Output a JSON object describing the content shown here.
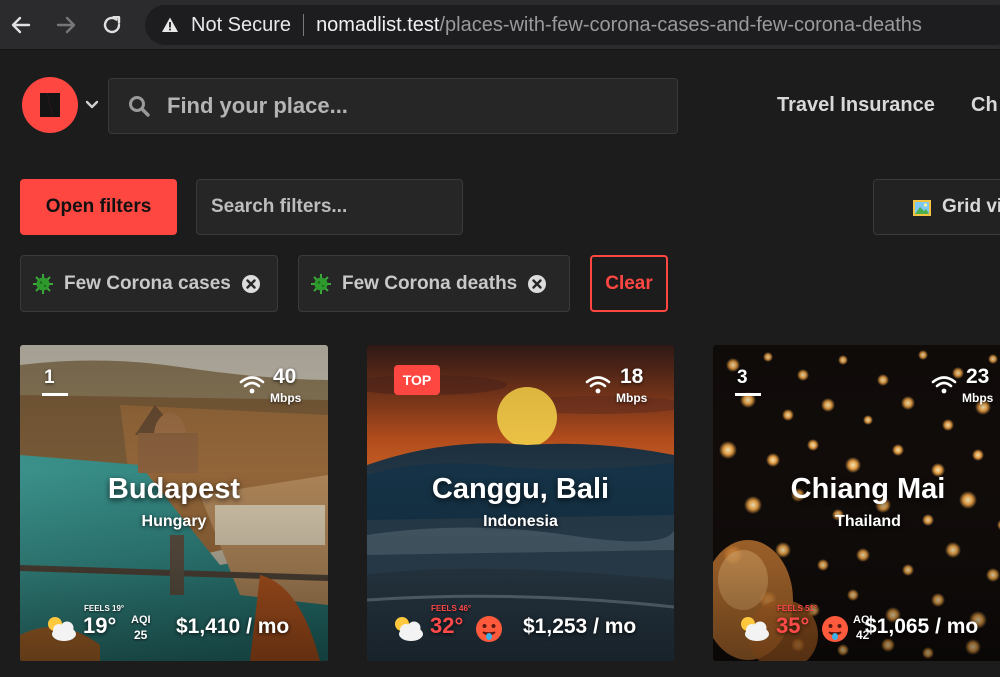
{
  "browser": {
    "security_label": "Not Secure",
    "url_host": "nomadlist.test",
    "url_path": "/places-with-few-corona-cases-and-few-corona-deaths"
  },
  "header": {
    "search_placeholder": "Find your place...",
    "nav_links": [
      "Travel Insurance",
      "Ch"
    ]
  },
  "filters": {
    "open_label": "Open filters",
    "search_placeholder": "Search filters...",
    "view_label": "Grid vi",
    "active": [
      {
        "label": "Few Corona cases",
        "icon": "virus-icon"
      },
      {
        "label": "Few Corona deaths",
        "icon": "virus-icon"
      }
    ],
    "clear_label": "Clear"
  },
  "colors": {
    "accent": "#ff4742",
    "background": "#1c1c1c",
    "hot_temp": "#ff4a4a"
  },
  "cards": [
    {
      "rank": "1",
      "badge": "",
      "speed": "40",
      "speed_unit": "Mbps",
      "city": "Budapest",
      "country": "Hungary",
      "feels_like": "FEELS 19°",
      "temp": "19°",
      "aqi_label": "AQI",
      "aqi_value": "25",
      "cost": "$1,410 / mo",
      "weather_icon": "partly-cloudy-icon"
    },
    {
      "rank": "",
      "badge": "TOP",
      "speed": "18",
      "speed_unit": "Mbps",
      "city": "Canggu, Bali",
      "country": "Indonesia",
      "feels_like": "FEELS 46°",
      "temp": "32°",
      "aqi_label": "",
      "aqi_value": "",
      "cost": "$1,253 / mo",
      "weather_icon": "partly-cloudy-icon"
    },
    {
      "rank": "3",
      "badge": "",
      "speed": "23",
      "speed_unit": "Mbps",
      "city": "Chiang Mai",
      "country": "Thailand",
      "feels_like": "FEELS 51°",
      "temp": "35°",
      "aqi_label": "AQI",
      "aqi_value": "42",
      "cost": "$1,065 / mo",
      "weather_icon": "partly-cloudy-icon"
    }
  ]
}
